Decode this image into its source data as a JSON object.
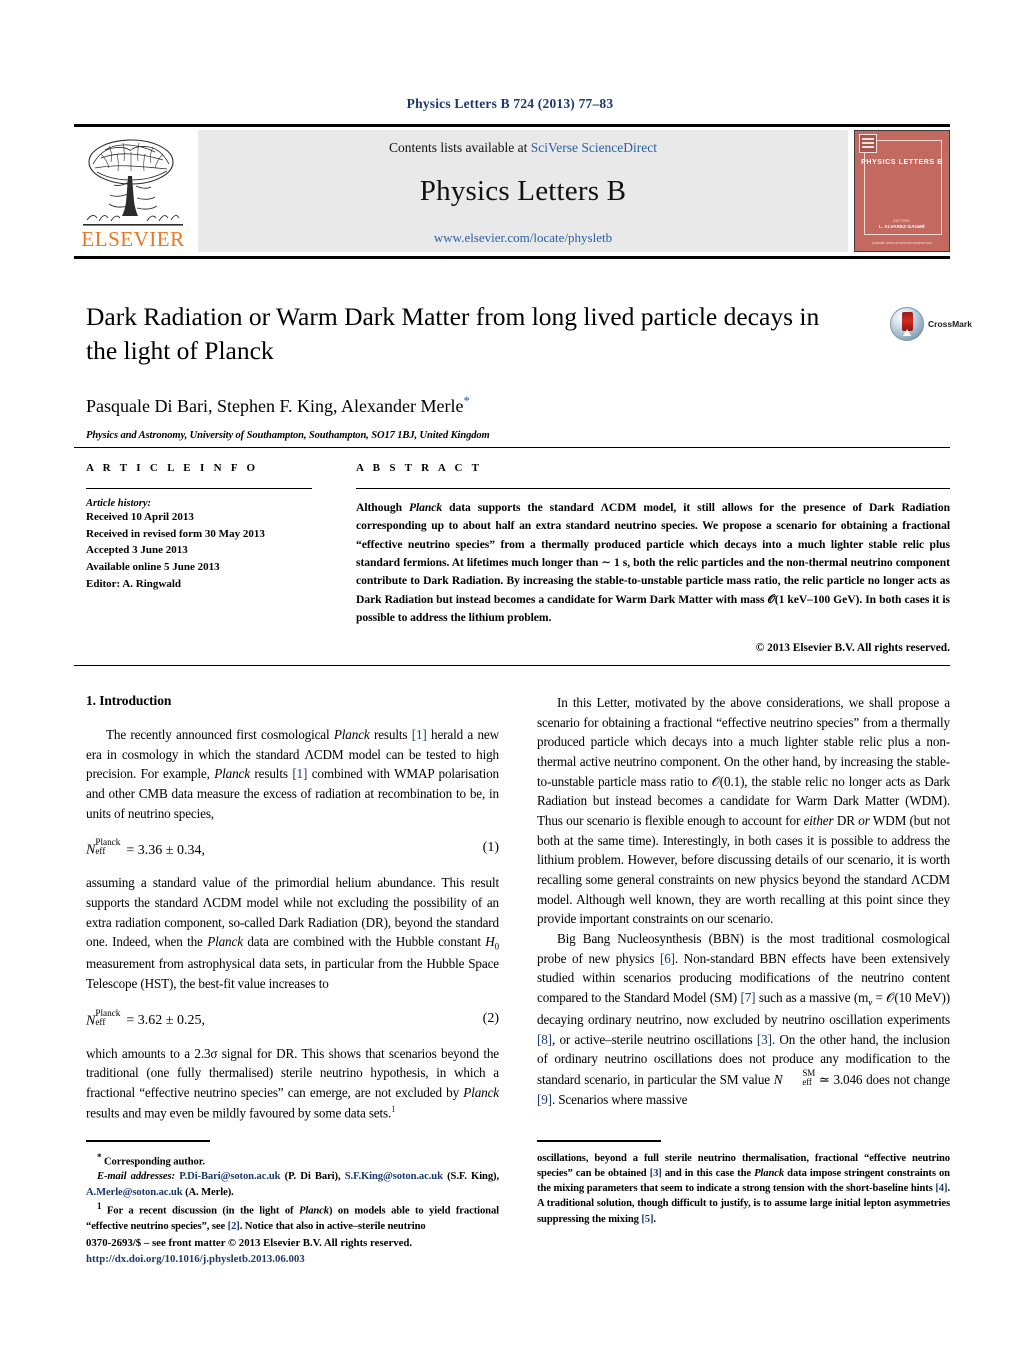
{
  "running_head": "Physics Letters B 724 (2013) 77–83",
  "masthead": {
    "contents_prefix": "Contents lists available at ",
    "contents_link": "SciVerse ScienceDirect",
    "journal_title": "Physics Letters B",
    "journal_url": "www.elsevier.com/locate/physletb",
    "publisher_wordmark": "ELSEVIER",
    "cover": {
      "title": "PHYSICS LETTERS B",
      "foot1": "EDITORS:",
      "foot2": "L. ALVAREZ-GAUMÉ",
      "foot3": "Available online at www.sciencedirect.com"
    }
  },
  "article": {
    "title": "Dark Radiation or Warm Dark Matter from long lived particle decays in the light of Planck",
    "authors": "Pasquale Di Bari, Stephen F. King, Alexander Merle",
    "corresponding_marker": "*",
    "affiliation": "Physics and Astronomy, University of Southampton, Southampton, SO17 1BJ, United Kingdom",
    "crossmark_label": "CrossMark"
  },
  "info": {
    "heading": "A R T I C L E    I N F O",
    "history_label": "Article history:",
    "history": [
      "Received 10 April 2013",
      "Received in revised form 30 May 2013",
      "Accepted 3 June 2013",
      "Available online 5 June 2013",
      "Editor: A. Ringwald"
    ]
  },
  "abstract": {
    "heading": "A B S T R A C T",
    "paragraph_1": "Although ",
    "planck_italic": "Planck",
    "paragraph_2": " data supports the standard ΛCDM model, it still allows for the presence of Dark Radiation corresponding up to about half an extra standard neutrino species. We propose a scenario for obtaining a fractional “effective neutrino species” from a thermally produced particle which decays into a much lighter stable relic plus standard fermions. At lifetimes much longer than ∼ 1 s, both the relic particles and the non-thermal neutrino component contribute to Dark Radiation. By increasing the stable-to-unstable particle mass ratio, the relic particle no longer acts as Dark Radiation but instead becomes a candidate for Warm Dark Matter with mass 𝒪(1 keV–100 GeV). In both cases it is possible to address the lithium problem.",
    "copyright": "© 2013 Elsevier B.V. All rights reserved."
  },
  "body": {
    "section_heading": "1. Introduction",
    "left_p1_a": "The recently announced first cosmological ",
    "left_p1_planck": "Planck",
    "left_p1_b": " results ",
    "left_p1_ref1": "[1]",
    "left_p1_c": " herald a new era in cosmology in which the standard ΛCDM model can be tested to high precision. For example, ",
    "left_p1_planck2": "Planck",
    "left_p1_d": " results ",
    "left_p1_ref2": "[1]",
    "left_p1_e": " combined with WMAP polarisation and other CMB data measure the excess of radiation at recombination to be, in units of neutrino species,",
    "eq1": {
      "symbol": "N",
      "sup": "Planck",
      "sub": "eff",
      "value": "= 3.36 ± 0.34,",
      "tag": "(1)"
    },
    "left_p2": "assuming a standard value of the primordial helium abundance. This result supports the standard ΛCDM model while not excluding the possibility of an extra radiation component, so-called Dark Radiation (DR), beyond the standard one. Indeed, when the ",
    "left_p2_planck": "Planck",
    "left_p2_b": " data are combined with the Hubble constant ",
    "left_p2_h0": "H",
    "left_p2_h0sub": "0",
    "left_p2_c": " measurement from astrophysical data sets, in particular from the Hubble Space Telescope (HST), the best-fit value increases to",
    "eq2": {
      "symbol": "N",
      "sup": "Planck",
      "sub": "eff",
      "value": "= 3.62 ± 0.25,",
      "tag": "(2)"
    },
    "left_p3_a": "which amounts to a 2.3σ signal for DR. This shows that scenarios beyond the traditional (one fully thermalised) sterile neutrino hypothesis, in which a fractional “effective neutrino species” can emerge, are not excluded by ",
    "left_p3_planck": "Planck",
    "left_p3_b": " results and may even be mildly favoured by some data sets.",
    "left_p3_fnmark": "1",
    "right_p1": "In this Letter, motivated by the above considerations, we shall propose a scenario for obtaining a fractional “effective neutrino species” from a thermally produced particle which decays into a much lighter stable relic plus a non-thermal active neutrino component. On the other hand, by increasing the stable-to-unstable particle mass ratio to 𝒪(0.1), the stable relic no longer acts as Dark Radiation but instead becomes a candidate for Warm Dark Matter (WDM). Thus our scenario is flexible enough to account for ",
    "right_p1_either": "either",
    "right_p1_b": " DR ",
    "right_p1_or": "or",
    "right_p1_c": " WDM (but not both at the same time). Interestingly, in both cases it is possible to address the lithium problem. However, before discussing details of our scenario, it is worth recalling some general constraints on new physics beyond the standard ΛCDM model. Although well known, they are worth recalling at this point since they provide important constraints on our scenario.",
    "right_p2_a": "Big Bang Nucleosynthesis (BBN) is the most traditional cosmological probe of new physics ",
    "right_p2_ref6": "[6]",
    "right_p2_b": ". Non-standard BBN effects have been extensively studied within scenarios producing modifications of the neutrino content compared to the Standard Model (SM) ",
    "right_p2_ref7": "[7]",
    "right_p2_c": " such as a massive (m",
    "right_p2_nu": "ν",
    "right_p2_d": " = 𝒪(10 MeV)) decaying ordinary neutrino, now excluded by neutrino oscillation experiments ",
    "right_p2_ref8": "[8]",
    "right_p2_e": ", or active–sterile neutrino oscillations ",
    "right_p2_ref3": "[3]",
    "right_p2_f": ". On the other hand, the inclusion of ordinary neutrino oscillations does not produce any modification to the standard scenario, in particular the SM value ",
    "right_p2_nsm": "N",
    "right_p2_nsm_sup": "SM",
    "right_p2_nsm_sub": "eff",
    "right_p2_g": " ≃ 3.046 does not change ",
    "right_p2_ref9": "[9]",
    "right_p2_h": ". Scenarios where massive"
  },
  "footnotes": {
    "left": {
      "star": "*",
      "corr": " Corresponding author.",
      "email_label": "E-mail addresses:",
      "email1": "P.Di-Bari@soton.ac.uk",
      "email1_name": " (P. Di Bari), ",
      "email2": "S.F.King@soton.ac.uk",
      "email2_name": " (S.F. King), ",
      "email3": "A.Merle@soton.ac.uk",
      "email3_name": " (A. Merle).",
      "fn1_mark": "1",
      "fn1_a": " For a recent discussion (in the light of ",
      "fn1_planck": "Planck",
      "fn1_b": ") on models able to yield fractional “effective neutrino species”, see ",
      "fn1_ref2": "[2]",
      "fn1_c": ". Notice that also in active–sterile neutrino"
    },
    "right": {
      "a": "oscillations, beyond a full sterile neutrino thermalisation, fractional “effective neutrino species” can be obtained ",
      "ref3": "[3]",
      "b": " and in this case the ",
      "planck": "Planck",
      "c": " data impose stringent constraints on the mixing parameters that seem to indicate a strong tension with the short-baseline hints ",
      "ref4": "[4]",
      "d": ". A traditional solution, though difficult to justify, is to assume large initial lepton asymmetries suppressing the mixing ",
      "ref5": "[5]",
      "e": "."
    }
  },
  "footer": {
    "issn_line": "0370-2693/$ – see front matter  © 2013 Elsevier B.V. All rights reserved.",
    "doi": "http://dx.doi.org/10.1016/j.physletb.2013.06.003"
  },
  "colors": {
    "link": "#2a5fa5",
    "reference": "#1b3a6b",
    "elsevier_orange": "#E87722",
    "cover_red": "#c4695f",
    "panel_grey": "#e9e9e9"
  }
}
